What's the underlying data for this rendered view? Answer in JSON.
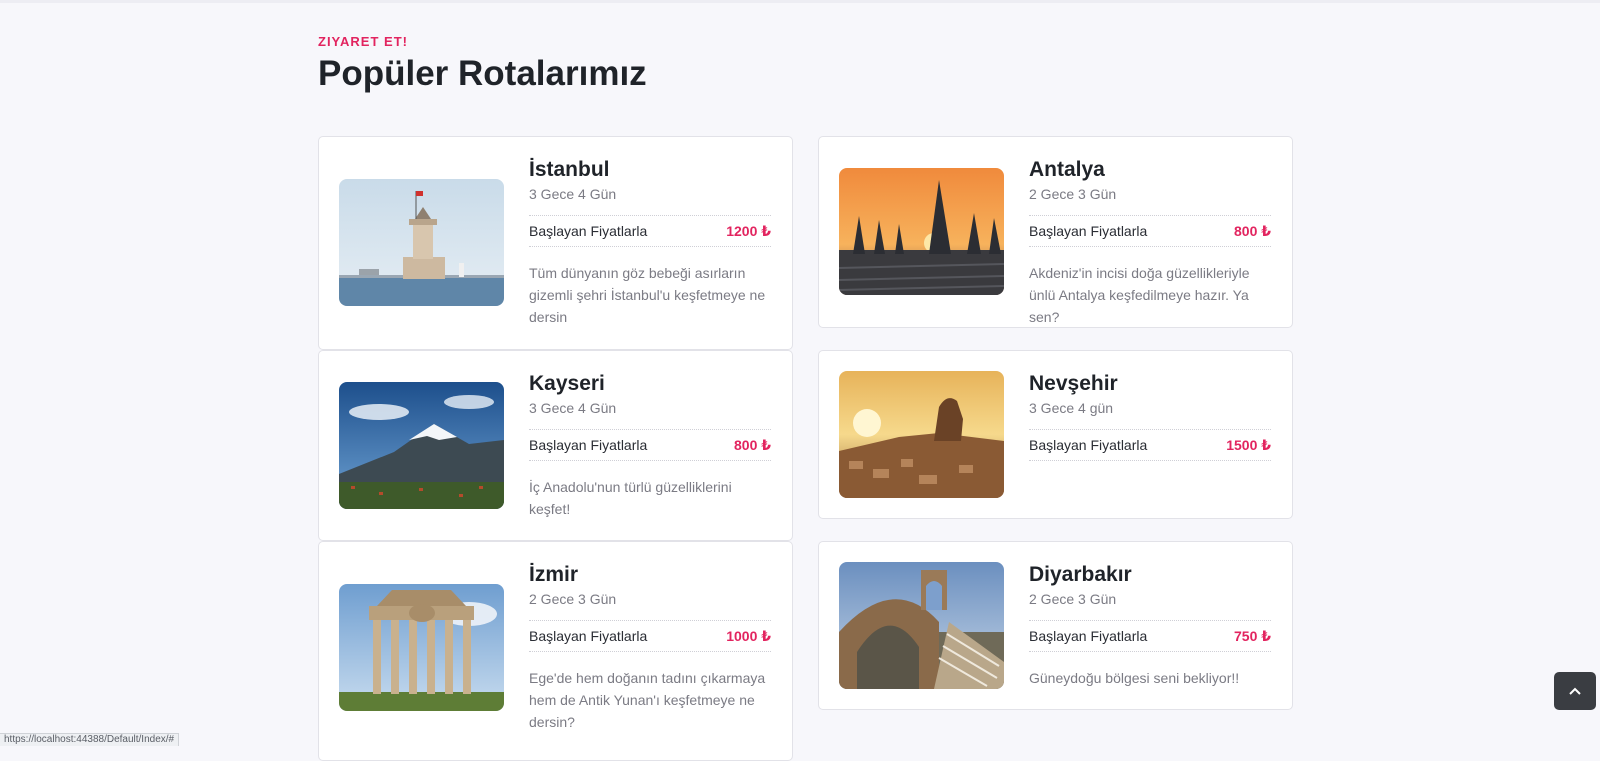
{
  "section": {
    "eyebrow": "ZIYARET ET!",
    "title": "Popüler Rotalarımız"
  },
  "price_label": "Başlayan Fiyatlarla",
  "accent_color": "#e2245f",
  "cards": {
    "istanbul": {
      "name": "İstanbul",
      "duration": "3 Gece 4 Gün",
      "price": "1200 ₺",
      "desc": "Tüm dünyanın göz bebeği asırların gizemli şehri İstanbul'u keşfetmeye ne dersin",
      "image": "maidens-tower-photo"
    },
    "kayseri": {
      "name": "Kayseri",
      "duration": "3 Gece 4 Gün",
      "price": "800 ₺",
      "desc": "İç Anadolu'nun türlü güzelliklerini keşfet!",
      "image": "snowy-mountain-photo"
    },
    "izmir": {
      "name": "İzmir",
      "duration": "2 Gece 3 Gün",
      "price": "1000 ₺",
      "desc": "Ege'de hem doğanın tadını çıkarmaya hem de Antik Yunan'ı keşfetmeye ne dersin?",
      "image": "ancient-gate-photo"
    },
    "antalya": {
      "name": "Antalya",
      "duration": "2 Gece 3 Gün",
      "price": "800 ₺",
      "desc": "Akdeniz'in incisi doğa güzellikleriyle ünlü Antalya keşfedilmeye hazır. Ya sen?",
      "image": "beach-umbrellas-sunset-photo"
    },
    "nevsehir": {
      "name": "Nevşehir",
      "duration": "3 Gece 4 gün",
      "price": "1500 ₺",
      "image": "cappadocia-sunset-photo"
    },
    "diyarbakir": {
      "name": "Diyarbakır",
      "duration": "2 Gece 3 Gün",
      "price": "750 ₺",
      "desc": "Güneydoğu bölgesi seni bekliyor!!",
      "image": "stone-bridge-photo"
    }
  },
  "status_url": "https://localhost:44388/Default/Index/#",
  "back_to_top_icon": "chevron-up-icon"
}
